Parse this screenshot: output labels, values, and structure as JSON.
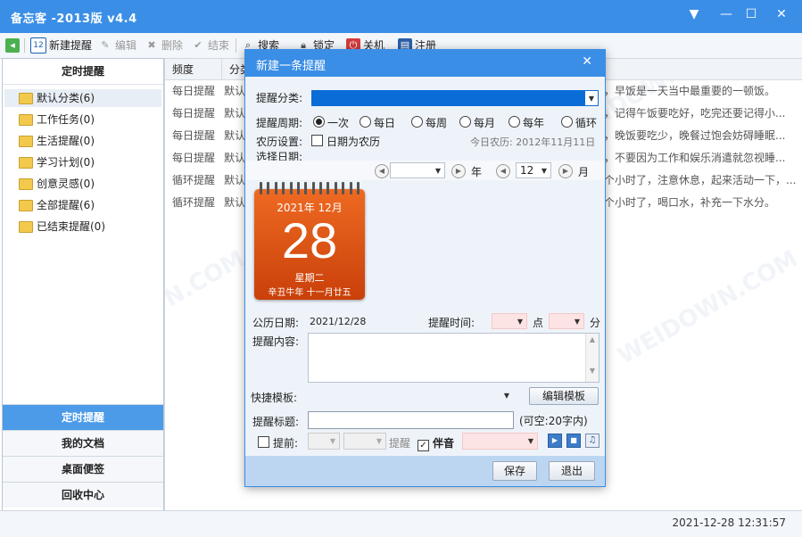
{
  "app": {
    "title": "备忘客 -2013版 v4.4"
  },
  "toolbar": {
    "items": [
      {
        "label": "新建提醒",
        "icon": "calendar-icon"
      },
      {
        "label": "编辑",
        "icon": "pencil-icon"
      },
      {
        "label": "删除",
        "icon": "delete-icon"
      },
      {
        "label": "结束",
        "icon": "check-icon"
      },
      {
        "label": "搜索",
        "icon": "search-icon"
      },
      {
        "label": "锁定",
        "icon": "lock-icon"
      },
      {
        "label": "关机",
        "icon": "power-icon"
      },
      {
        "label": "注册",
        "icon": "register-icon"
      }
    ]
  },
  "sidebar": {
    "header": "定时提醒",
    "categories": [
      {
        "label": "默认分类(6)"
      },
      {
        "label": "工作任务(0)"
      },
      {
        "label": "生活提醒(0)"
      },
      {
        "label": "学习计划(0)"
      },
      {
        "label": "创意灵感(0)"
      },
      {
        "label": "全部提醒(6)"
      },
      {
        "label": "已结束提醒(0)"
      }
    ],
    "nav": [
      {
        "label": "定时提醒",
        "active": true
      },
      {
        "label": "我的文档"
      },
      {
        "label": "桌面便签"
      },
      {
        "label": "回收中心"
      }
    ]
  },
  "table": {
    "columns": [
      "频度",
      "分类"
    ],
    "rows": [
      {
        "freq": "每日提醒",
        "cat": "默认",
        "text": "，早饭是一天当中最重要的一顿饭。"
      },
      {
        "freq": "每日提醒",
        "cat": "默认",
        "text": "，记得午饭要吃好，吃完还要记得小..."
      },
      {
        "freq": "每日提醒",
        "cat": "默认",
        "text": "，晚饭要吃少，晚餐过饱会妨碍睡眠..."
      },
      {
        "freq": "每日提醒",
        "cat": "默认",
        "text": "，不要因为工作和娱乐消遣就忽视睡..."
      },
      {
        "freq": "循环提醒",
        "cat": "默认",
        "text": "个小时了，注意休息，起来活动一下，..."
      },
      {
        "freq": "循环提醒",
        "cat": "默认",
        "text": "个小时了，喝口水，补充一下水分。"
      }
    ]
  },
  "status": {
    "datetime": "2021-12-28 12:31:57"
  },
  "dialog": {
    "title": "新建一条提醒",
    "category_label": "提醒分类:",
    "period_label": "提醒周期:",
    "periods": [
      {
        "label": "一次",
        "selected": true
      },
      {
        "label": "每日"
      },
      {
        "label": "每周"
      },
      {
        "label": "每月"
      },
      {
        "label": "每年"
      },
      {
        "label": "循环"
      }
    ],
    "lunar_label": "农历设置:",
    "lunar_checkbox": "日期为农历",
    "today_lunar": "今日农历: 2012年11月11日",
    "select_date_label": "选择日期:",
    "year_unit": "年",
    "month_value": "12",
    "month_unit": "月",
    "calendar": {
      "year_month": "2021年  12月",
      "day": "28",
      "weekday": "星期二",
      "lunar": "辛丑牛年  十一月廿五"
    },
    "solar_date_label": "公历日期:",
    "solar_date": "2021/12/28",
    "remind_time_label": "提醒时间:",
    "hour_unit": "点",
    "minute_unit": "分",
    "content_label": "提醒内容:",
    "template_label": "快捷模板:",
    "edit_template_btn": "编辑模板",
    "title_label": "提醒标题:",
    "title_hint": "(可空:20字内)",
    "advance_label": "提前:",
    "remind_label": "提醒",
    "sound_label": "伴音",
    "save_btn": "保存",
    "exit_btn": "退出"
  },
  "watermark": "WEIDOWN.COM",
  "colors": {
    "titlebar": "#3a8ee6",
    "calendar": "#e35a17",
    "selected_field": "#0a6cd6"
  }
}
